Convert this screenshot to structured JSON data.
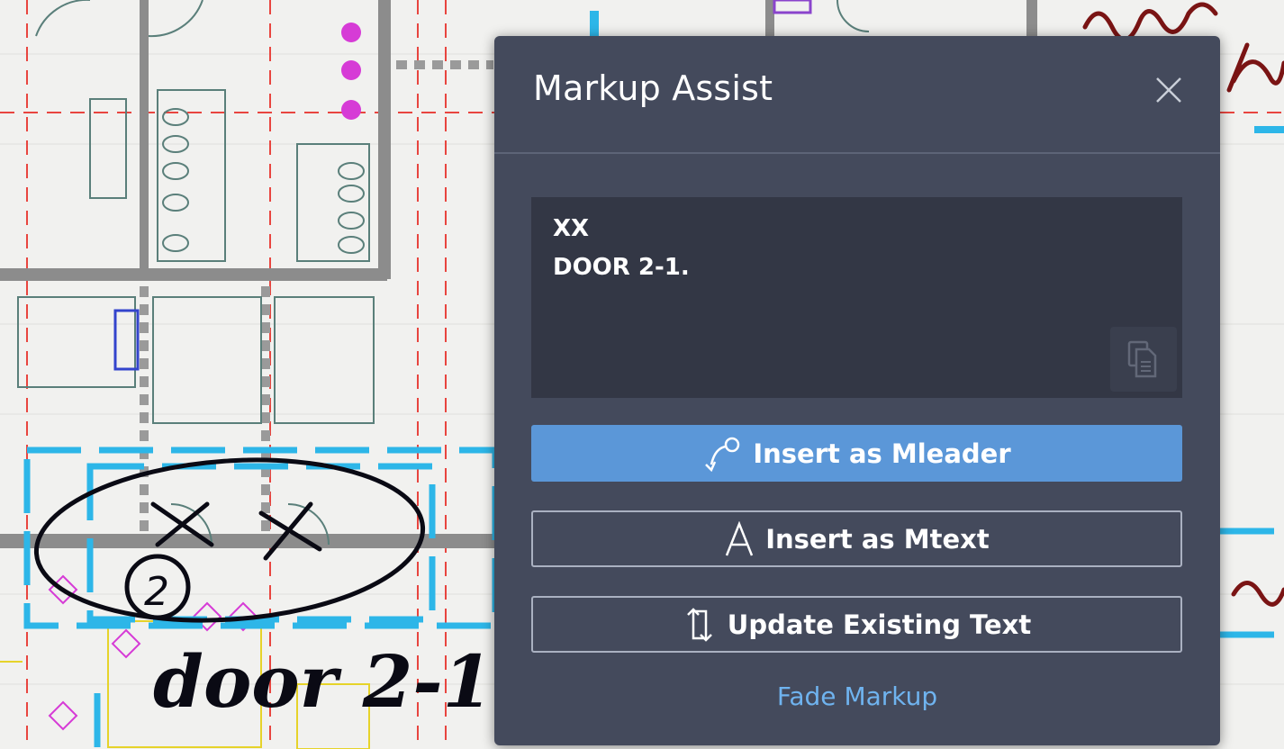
{
  "background": {
    "description_free": true,
    "handwritten_markup": "door 2-1.",
    "handwritten_number": "2",
    "colors": {
      "paper": "#f1f1ef",
      "wall": "#8a8a8a",
      "red_line": "#e8453f",
      "cyan_highlight": "#2db6e8",
      "magenta_symbol": "#d63bd6",
      "ink": "#0a0a14",
      "red_ink": "#7a1414"
    }
  },
  "panel": {
    "title": "Markup Assist",
    "close_icon": "close-icon",
    "recognized_text": {
      "line1": "XX",
      "line2": "DOOR 2-1."
    },
    "copy_icon": "copy-icon",
    "buttons": {
      "mleader_label": "Insert as Mleader",
      "mleader_icon": "leader-icon",
      "mtext_label": "Insert as Mtext",
      "mtext_icon": "text-a-icon",
      "update_label": "Update Existing Text",
      "update_icon": "swap-arrows-icon"
    },
    "fade_link": "Fade Markup",
    "colors": {
      "panel_bg": "#444a5c",
      "textbox_bg": "#333745",
      "primary": "#5b97d8",
      "link": "#6fb3ef"
    }
  }
}
